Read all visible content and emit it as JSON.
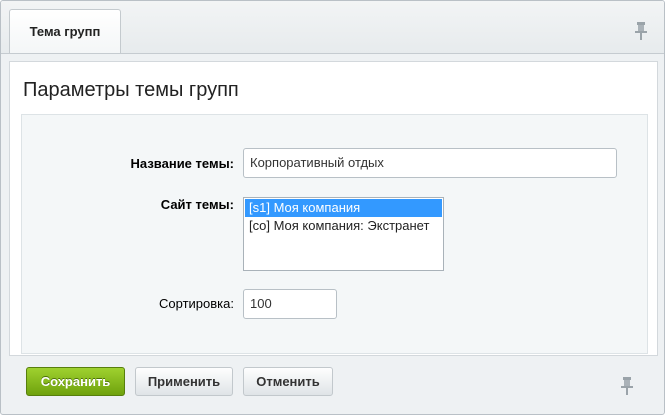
{
  "tabs": [
    {
      "label": "Тема групп",
      "active": true
    }
  ],
  "page": {
    "title": "Параметры темы групп"
  },
  "form": {
    "name": {
      "label": "Название темы:",
      "value": "Корпоративный отдых"
    },
    "site": {
      "label": "Сайт темы:",
      "options": [
        {
          "label": "[s1] Моя компания",
          "selected": true
        },
        {
          "label": "[co] Моя компания: Экстранет",
          "selected": false
        }
      ]
    },
    "sort": {
      "label": "Сортировка:",
      "value": "100"
    }
  },
  "buttons": {
    "save": "Сохранить",
    "apply": "Применить",
    "cancel": "Отменить"
  },
  "icons": {
    "pin_top": "pin-icon",
    "pin_bottom": "pin-icon"
  },
  "colors": {
    "save_button": "#7fb518",
    "selected_option": "#3399ff"
  }
}
